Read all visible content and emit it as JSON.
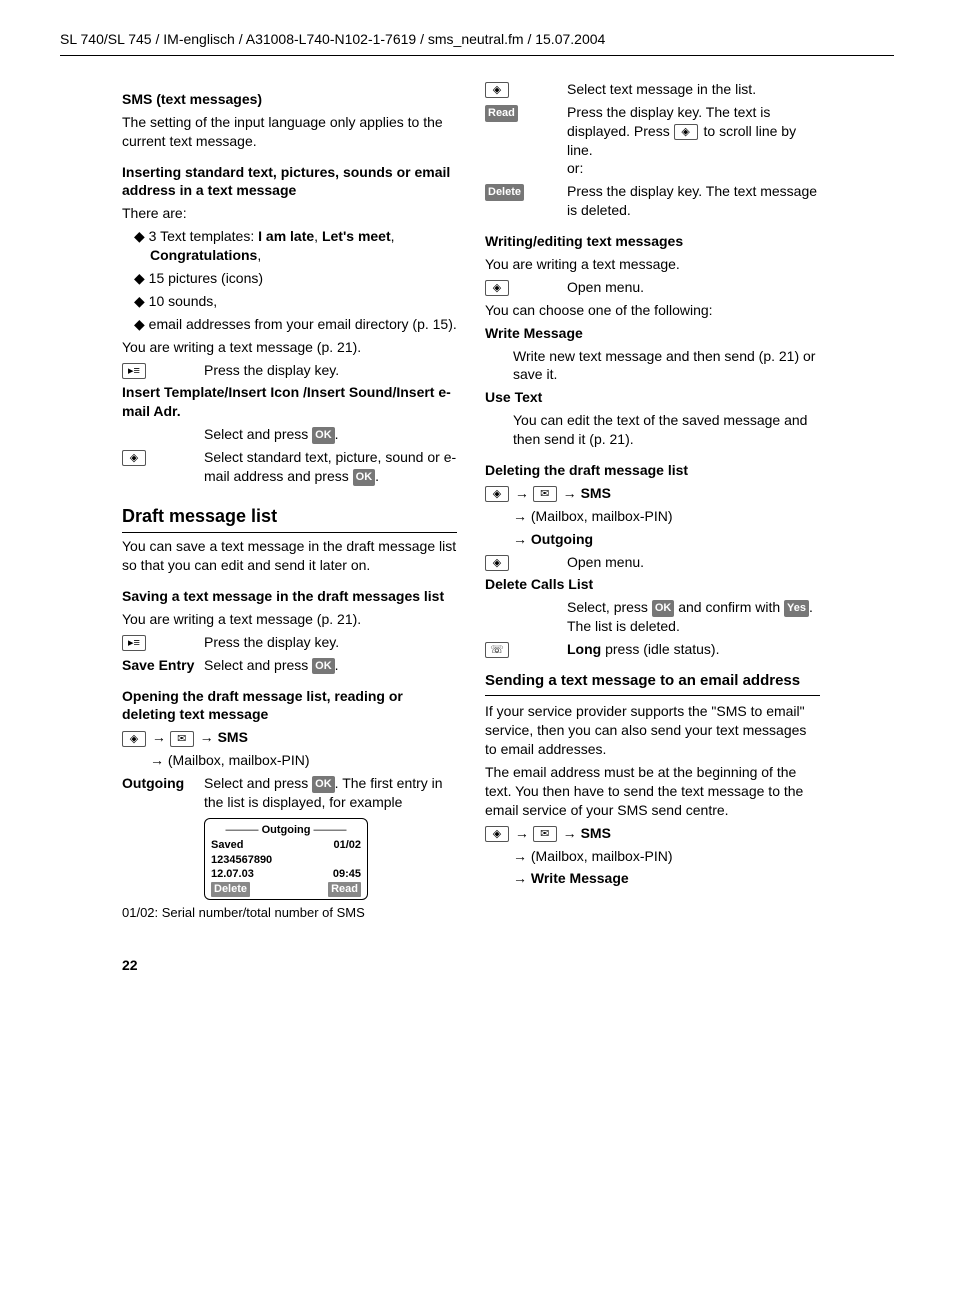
{
  "header": "SL 740/SL 745 / IM-englisch / A31008-L740-N102-1-7619 / sms_neutral.fm / 15.07.2004",
  "sec_title": "SMS (text messages)",
  "page_number": "22",
  "left": {
    "intro": "The setting of the input language only applies to the current text message.",
    "h_insert": "Inserting standard text, pictures, sounds or email address in a text message",
    "there_are": "There are:",
    "bullets": {
      "b1a": "3 Text templates: ",
      "b1b": "I am late",
      "b1c": ", ",
      "b1d": "Let's meet",
      "b1e": ", ",
      "b1f": "Congratulations",
      "b1g": ",",
      "b2": "15 pictures (icons)",
      "b3": "10 sounds,",
      "b4": "email addresses from your email directory (p. 15)."
    },
    "writing": "You are writing a text message (p. 21).",
    "press_display": "Press the display key.",
    "insert_line": "Insert Template/Insert Icon /Insert Sound/Insert e-mail Adr.",
    "select_ok": "Select and press ",
    "select_std": "Select standard text, picture, sound or e-mail address and press ",
    "h2_draft": "Draft message list",
    "draft_intro": "You can save a text message in the draft message list so that you can edit and send it later on.",
    "h_saving": "Saving a text message in the draft messages list",
    "save_entry": "Save Entry",
    "h_opening": "Opening the draft message list, reading or deleting text message",
    "nav_sms": "SMS",
    "mailbox": "(Mailbox, mailbox-PIN)",
    "outgoing": "Outgoing",
    "outgoing_desc": ". The first entry in the list is displayed, for example",
    "display": {
      "title": "Outgoing",
      "r1a": "Saved",
      "r1b": "01/02",
      "r2": "1234567890",
      "r3a": "12.07.03",
      "r3b": "09:45",
      "btn1": "Delete",
      "btn2": "Read"
    },
    "caption": "01/02: Serial number/total number of SMS"
  },
  "right": {
    "sel_msg": "Select text message in the list.",
    "read": "Read",
    "read_desc1": "Press the display key. The text is displayed. Press ",
    "read_desc2": " to scroll line by line.",
    "or": "or:",
    "delete": "Delete",
    "del_desc": "Press the display key. The text message is deleted.",
    "h_writing": "Writing/editing text messages",
    "writing_intro": "You are writing a text message.",
    "open_menu": "Open menu.",
    "choose": "You can choose one of the following:",
    "wm": "Write Message",
    "wm_desc": "Write new text message and then send (p. 21) or save it.",
    "ut": "Use Text",
    "ut_desc": "You can edit the text of the saved message and then send it (p. 21).",
    "h_del_draft": "Deleting the draft message list",
    "outgoing_b": "Outgoing",
    "dcl": "Delete Calls List",
    "dcl_desc1": "Select, press ",
    "dcl_desc2": " and confirm with ",
    "dcl_desc3": ". The list is deleted.",
    "long_press_b": "Long",
    "long_press": " press (idle status).",
    "h_email": "Sending a text message to an email address",
    "email_p1": "If your service provider supports the \"SMS to email\" service, then you can also send your text messages to email addresses.",
    "email_p2": "The email address must be at the beginning of the text. You then have to send the text message to the email service of your SMS send centre.",
    "wm_b": "Write Message"
  },
  "pills": {
    "ok": "OK",
    "yes": "Yes"
  }
}
